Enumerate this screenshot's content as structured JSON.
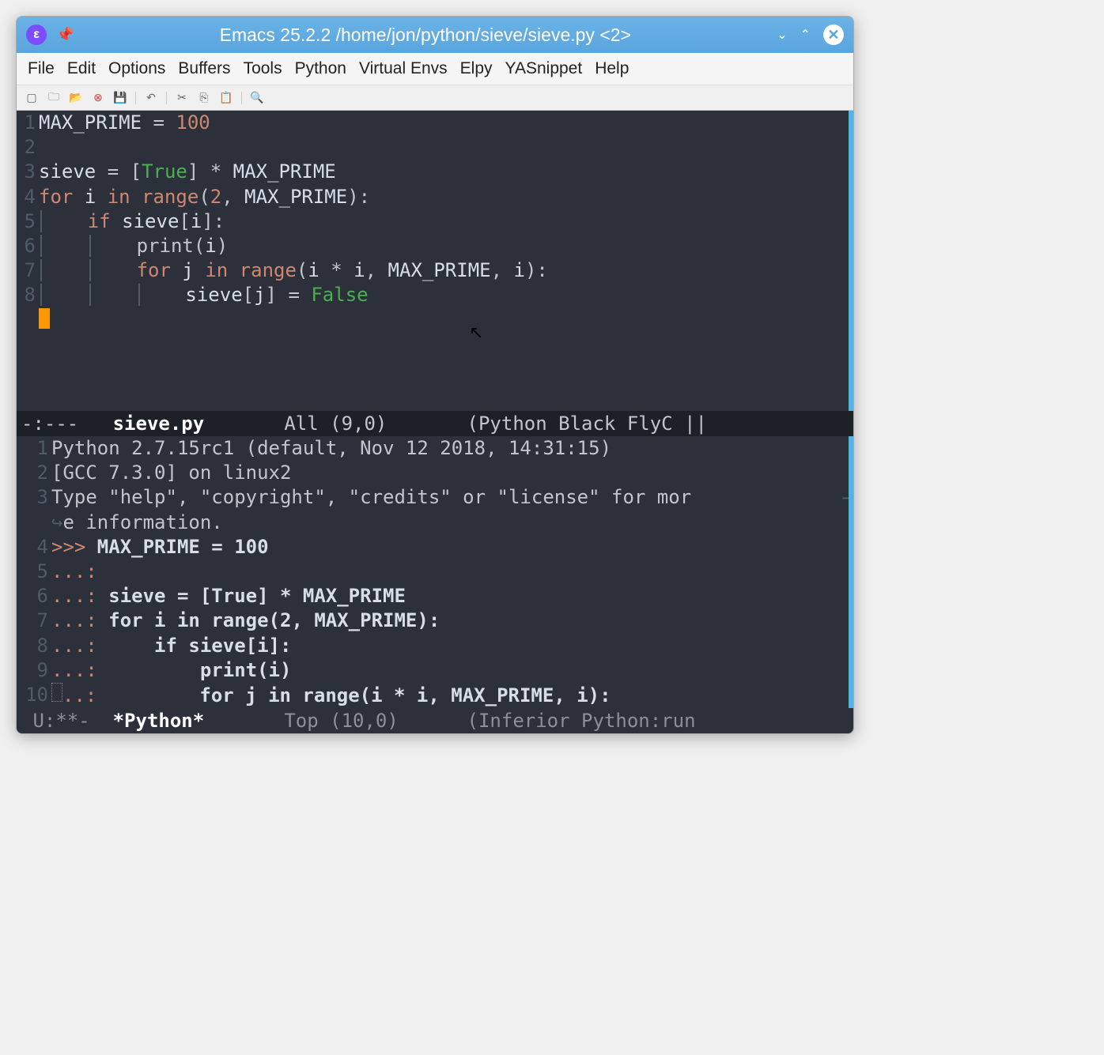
{
  "window": {
    "title": "Emacs 25.2.2 /home/jon/python/sieve/sieve.py <2>"
  },
  "menubar": [
    "File",
    "Edit",
    "Options",
    "Buffers",
    "Tools",
    "Python",
    "Virtual Envs",
    "Elpy",
    "YASnippet",
    "Help"
  ],
  "toolbar_icons": [
    "new-file",
    "open-recent",
    "open-folder",
    "close",
    "save",
    "sep",
    "undo",
    "sep",
    "cut",
    "copy",
    "paste",
    "sep",
    "search"
  ],
  "editor": {
    "lines": [
      {
        "num": "1",
        "tokens": [
          [
            "var",
            "MAX_PRIME"
          ],
          [
            "op",
            " = "
          ],
          [
            "num",
            "100"
          ]
        ]
      },
      {
        "num": "2",
        "tokens": []
      },
      {
        "num": "3",
        "tokens": [
          [
            "var",
            "sieve"
          ],
          [
            "op",
            " = "
          ],
          [
            "punct",
            "["
          ],
          [
            "builtin",
            "True"
          ],
          [
            "punct",
            "]"
          ],
          [
            "op",
            " * "
          ],
          [
            "var",
            "MAX_PRIME"
          ]
        ]
      },
      {
        "num": "4",
        "tokens": [
          [
            "keyword",
            "for"
          ],
          [
            "op",
            " "
          ],
          [
            "var",
            "i"
          ],
          [
            "op",
            " "
          ],
          [
            "keyword",
            "in"
          ],
          [
            "op",
            " "
          ],
          [
            "keyword",
            "range"
          ],
          [
            "punct",
            "("
          ],
          [
            "num",
            "2"
          ],
          [
            "punct",
            ", "
          ],
          [
            "var",
            "MAX_PRIME"
          ],
          [
            "punct",
            "):"
          ]
        ]
      },
      {
        "num": "5",
        "tokens": [
          [
            "indent",
            "    "
          ],
          [
            "keyword",
            "if"
          ],
          [
            "op",
            " "
          ],
          [
            "var",
            "sieve"
          ],
          [
            "punct",
            "["
          ],
          [
            "var",
            "i"
          ],
          [
            "punct",
            "]:"
          ]
        ]
      },
      {
        "num": "6",
        "tokens": [
          [
            "indent",
            "    "
          ],
          [
            "indent",
            "    "
          ],
          [
            "func",
            "print"
          ],
          [
            "punct",
            "("
          ],
          [
            "var",
            "i"
          ],
          [
            "punct",
            ")"
          ]
        ]
      },
      {
        "num": "7",
        "tokens": [
          [
            "indent",
            "    "
          ],
          [
            "indent",
            "    "
          ],
          [
            "keyword",
            "for"
          ],
          [
            "op",
            " "
          ],
          [
            "var",
            "j"
          ],
          [
            "op",
            " "
          ],
          [
            "keyword",
            "in"
          ],
          [
            "op",
            " "
          ],
          [
            "keyword",
            "range"
          ],
          [
            "punct",
            "("
          ],
          [
            "var",
            "i"
          ],
          [
            "op",
            " * "
          ],
          [
            "var",
            "i"
          ],
          [
            "punct",
            ", "
          ],
          [
            "var",
            "MAX_PRIME"
          ],
          [
            "punct",
            ", "
          ],
          [
            "var",
            "i"
          ],
          [
            "punct",
            "):"
          ]
        ]
      },
      {
        "num": "8",
        "tokens": [
          [
            "indent",
            "    "
          ],
          [
            "indent",
            "    "
          ],
          [
            "indent",
            "    "
          ],
          [
            "var",
            "sieve"
          ],
          [
            "punct",
            "["
          ],
          [
            "var",
            "j"
          ],
          [
            "punct",
            "]"
          ],
          [
            "op",
            " = "
          ],
          [
            "false",
            "False"
          ]
        ]
      }
    ]
  },
  "modeline1": {
    "prefix": "-:---   ",
    "filename": "sieve.py",
    "middle": "       All (9,0)       ",
    "modes": "(Python Black FlyC ||"
  },
  "repl": {
    "lines": [
      {
        "num": "1",
        "text": "Python 2.7.15rc1 (default, Nov 12 2018, 14:31:15)"
      },
      {
        "num": "2",
        "text": "[GCC 7.3.0] on linux2"
      },
      {
        "num": "3",
        "text": "Type \"help\", \"copyright\", \"credits\" or \"license\" for mor",
        "wraps": true,
        "cont": "e information."
      },
      {
        "num": "4",
        "prompt": ">>> ",
        "bold": "MAX_PRIME = 100"
      },
      {
        "num": "5",
        "prompt": "...: "
      },
      {
        "num": "6",
        "prompt": "...: ",
        "bold": "sieve = [True] * MAX_PRIME"
      },
      {
        "num": "7",
        "prompt": "...: ",
        "bold": "for i in range(2, MAX_PRIME):"
      },
      {
        "num": "8",
        "prompt": "...: ",
        "bold": "    if sieve[i]:"
      },
      {
        "num": "9",
        "prompt": "...: ",
        "bold": "        print(i)"
      },
      {
        "num": "10",
        "prompt": "...: ",
        "bold": "        for j in range(i * i, MAX_PRIME, i):",
        "boxcursor": true
      }
    ]
  },
  "modeline2": {
    "prefix": " U:**-  ",
    "filename": "*Python*",
    "middle": "       Top (10,0)      ",
    "modes": "(Inferior Python:run "
  }
}
